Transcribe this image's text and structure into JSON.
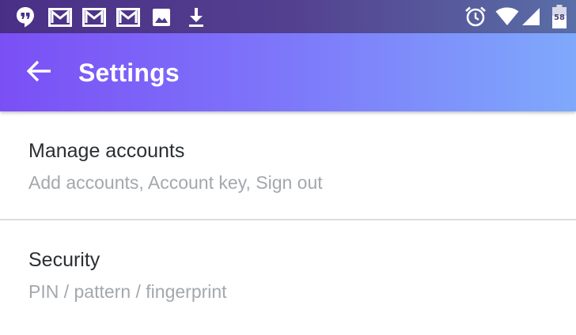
{
  "status_bar": {
    "left_icons": [
      "hangouts-icon",
      "gmail-icon",
      "gmail-icon",
      "gmail-icon",
      "image-icon",
      "download-icon"
    ],
    "right_icons": [
      "alarm-icon",
      "wifi-icon",
      "cell-signal-icon",
      "battery-icon"
    ],
    "battery_level": "58"
  },
  "app_bar": {
    "title": "Settings",
    "back_icon": "arrow-back-icon",
    "colors": {
      "start": "#7b4ff5",
      "end": "#7fa9fb"
    }
  },
  "items": [
    {
      "title": "Manage accounts",
      "subtitle": "Add accounts, Account key, Sign out"
    },
    {
      "title": "Security",
      "subtitle": "PIN / pattern / fingerprint"
    }
  ]
}
